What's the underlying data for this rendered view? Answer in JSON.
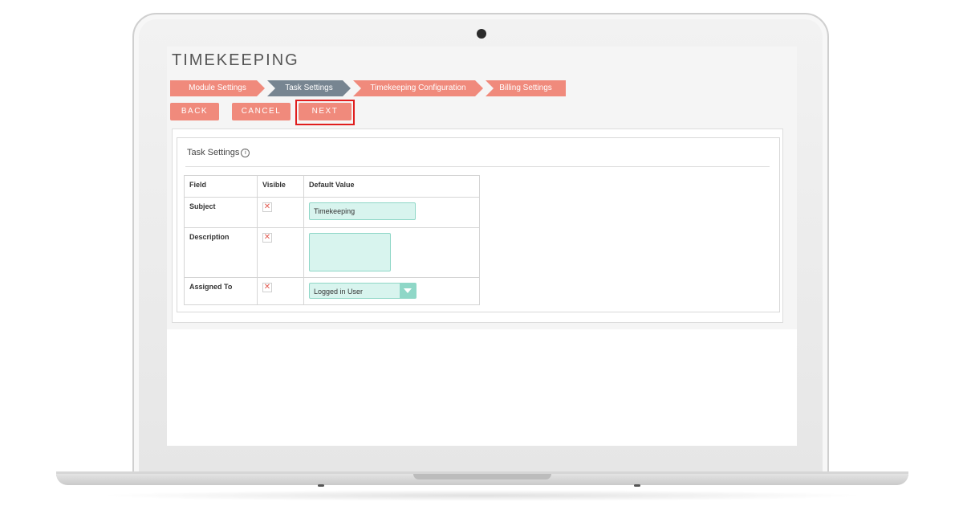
{
  "page": {
    "title": "TIMEKEEPING"
  },
  "wizard_steps": [
    {
      "label": "Module Settings",
      "state": "done"
    },
    {
      "label": "Task Settings",
      "state": "active"
    },
    {
      "label": "Timekeeping Configuration",
      "state": "pending"
    },
    {
      "label": "Billing Settings",
      "state": "pending"
    }
  ],
  "actions": {
    "back": "BACK",
    "cancel": "CANCEL",
    "next": "NEXT"
  },
  "panel": {
    "title": "Task Settings",
    "info_icon": "info-icon",
    "columns": [
      "Field",
      "Visible",
      "Default Value"
    ],
    "rows": [
      {
        "field": "Subject",
        "visible_icon": "x-icon",
        "default": "Timekeeping",
        "control": "text"
      },
      {
        "field": "Description",
        "visible_icon": "x-icon",
        "default": "",
        "control": "textarea"
      },
      {
        "field": "Assigned To",
        "visible_icon": "x-icon",
        "default": "Logged in User",
        "control": "select"
      }
    ]
  },
  "colors": {
    "accent": "#f08a7c",
    "active_step": "#778591",
    "input_bg": "#d8f4ee",
    "highlight": "#e01e1e"
  }
}
